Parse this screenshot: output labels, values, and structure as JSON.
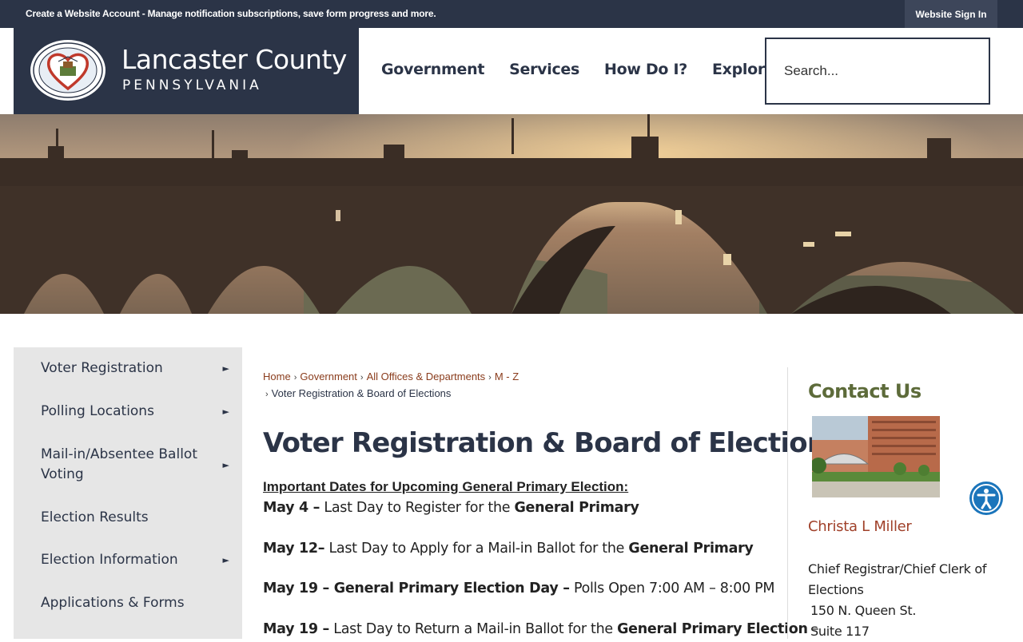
{
  "topbar": {
    "promo": "Create a Website Account - Manage notification subscriptions, save form progress and more.",
    "signin": "Website Sign In"
  },
  "header": {
    "logo_title": "Lancaster County",
    "logo_subtitle": "PENNSYLVANIA",
    "nav": [
      "Government",
      "Services",
      "How Do I?",
      "Explore"
    ],
    "search_placeholder": "Search..."
  },
  "sidebar": {
    "items": [
      {
        "label": "Voter Registration",
        "has_submenu": true
      },
      {
        "label": "Polling Locations",
        "has_submenu": true
      },
      {
        "label": "Mail-in/Absentee Ballot Voting",
        "has_submenu": true
      },
      {
        "label": "Election Results",
        "has_submenu": false
      },
      {
        "label": "Election Information",
        "has_submenu": true
      },
      {
        "label": "Applications & Forms",
        "has_submenu": false
      }
    ],
    "arrow_glyph": "►"
  },
  "breadcrumb": {
    "items": [
      "Home",
      "Government",
      "All Offices & Departments",
      "M - Z"
    ],
    "current": "Voter Registration & Board of Elections",
    "sep": "›"
  },
  "main": {
    "title": "Voter Registration & Board of Elections",
    "dates_heading": "Important Dates for Upcoming General Primary Election:",
    "dates": {
      "l1_b": "May 4 –",
      "l1_t": " Last Day to Register for the ",
      "l1_b2": "General Primary",
      "l2_b": "May 12–",
      "l2_t": " Last Day to Apply for a Mail-in Ballot for the ",
      "l2_b2": "General Primary",
      "l3_b": "May 19 – General Primary Election Day –",
      "l3_t": " Polls Open 7:00 AM – 8:00 PM",
      "l4_b": "May 19 –",
      "l4_t": " Last Day to Return a Mail-in Ballot for the ",
      "l4_b2": "General Primary Election",
      "l4_t2": " –"
    }
  },
  "contact": {
    "title": "Contact Us",
    "name": "Christa L Miller",
    "role": "Chief Registrar/Chief Clerk of Elections",
    "address_line1": "150 N. Queen St.",
    "address_line2": "Suite 117"
  },
  "colors": {
    "navy": "#2b3447",
    "link": "#8a3c1c",
    "contact_title": "#5d6b3a",
    "contact_name": "#a0412a",
    "a11y": "#1b75bb"
  }
}
